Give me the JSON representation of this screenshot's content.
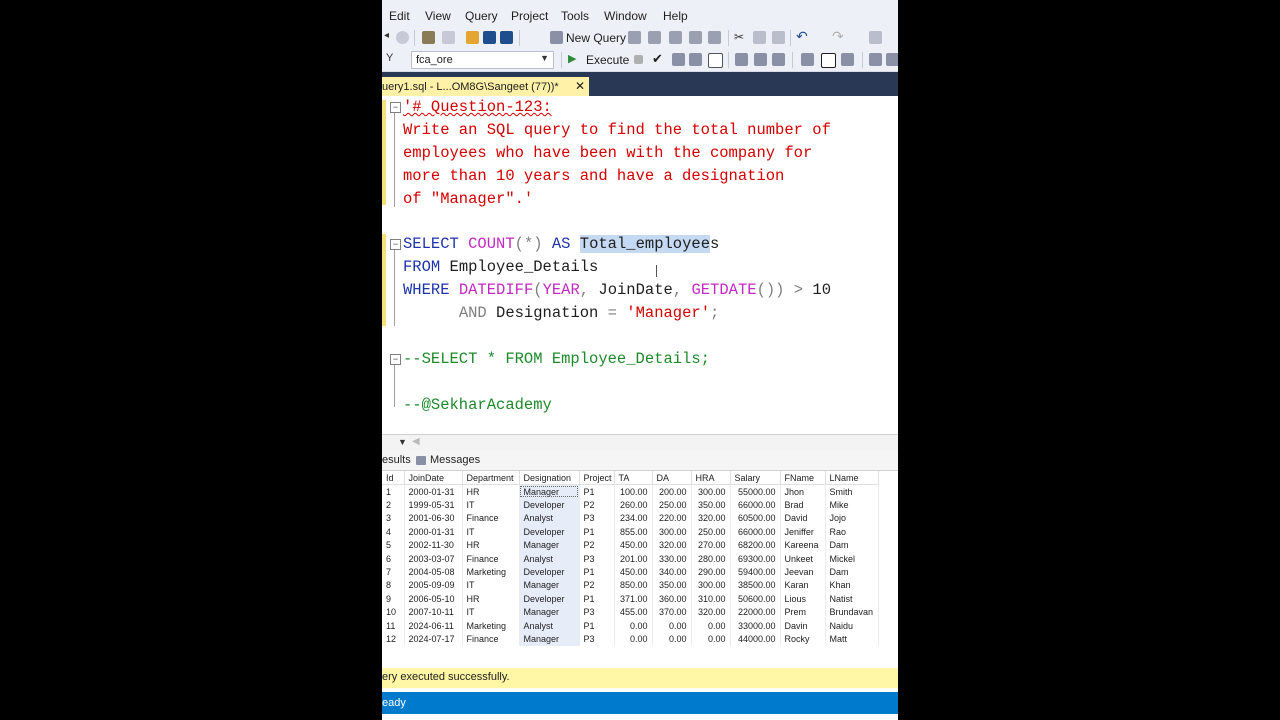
{
  "menu": {
    "items": [
      "Edit",
      "View",
      "Query",
      "Project",
      "Tools",
      "Window",
      "Help"
    ]
  },
  "toolbar": {
    "new_query_label": "New Query",
    "database_value": "fca_ore",
    "execute_label": "Execute"
  },
  "tab": {
    "title": "uery1.sql - L...OM8G\\Sangeet (77))*",
    "close": "✕"
  },
  "editor": {
    "comment_lines": [
      "'# Question-123:",
      "Write an SQL query to find the total number of",
      "employees who have been with the company for",
      "more than 10 years and have a designation",
      "of \"Manager\".'"
    ],
    "q_select": "SELECT",
    "q_count": "COUNT",
    "q_paren": "(*)",
    "q_as": "AS",
    "q_alias": "Total_employee",
    "q_alias_tail": "s",
    "q_from": "FROM",
    "q_table": "Employee_Details",
    "q_where": "WHERE",
    "q_datediff": "DATEDIFF",
    "q_open": "(",
    "q_year": "YEAR",
    "q_comma1": ",",
    "q_joindate": "JoinDate",
    "q_comma2": ",",
    "q_getdate": "GETDATE",
    "q_parens": "())",
    "q_gt": ">",
    "q_ten": "10",
    "q_and": "AND",
    "q_designation": "Designation",
    "q_eq": "=",
    "q_manager": "'Manager'",
    "q_semi": ";",
    "commented_select": "--SELECT * FROM Employee_Details;",
    "signature": "--@SekharAcademy"
  },
  "results": {
    "tabs": [
      "esults",
      "Messages"
    ],
    "columns": [
      "Id",
      "JoinDate",
      "Department",
      "Designation",
      "Project",
      "TA",
      "DA",
      "HRA",
      "Salary",
      "FName",
      "LName"
    ],
    "rows": [
      [
        "1",
        "2000-01-31",
        "HR",
        "Manager",
        "P1",
        "100.00",
        "200.00",
        "300.00",
        "55000.00",
        "Jhon",
        "Smith"
      ],
      [
        "2",
        "1999-05-31",
        "IT",
        "Developer",
        "P2",
        "260.00",
        "250.00",
        "350.00",
        "66000.00",
        "Brad",
        "Mike"
      ],
      [
        "3",
        "2001-06-30",
        "Finance",
        "Analyst",
        "P3",
        "234.00",
        "220.00",
        "320.00",
        "60500.00",
        "David",
        "Jojo"
      ],
      [
        "4",
        "2000-01-31",
        "IT",
        "Developer",
        "P1",
        "855.00",
        "300.00",
        "250.00",
        "66000.00",
        "Jeniffer",
        "Rao"
      ],
      [
        "5",
        "2002-11-30",
        "HR",
        "Manager",
        "P2",
        "450.00",
        "320.00",
        "270.00",
        "68200.00",
        "Kareena",
        "Dam"
      ],
      [
        "6",
        "2003-03-07",
        "Finance",
        "Analyst",
        "P3",
        "201.00",
        "330.00",
        "280.00",
        "69300.00",
        "Unkeet",
        "Mickel"
      ],
      [
        "7",
        "2004-05-08",
        "Marketing",
        "Developer",
        "P1",
        "450.00",
        "340.00",
        "290.00",
        "59400.00",
        "Jeevan",
        "Dam"
      ],
      [
        "8",
        "2005-09-09",
        "IT",
        "Manager",
        "P2",
        "850.00",
        "350.00",
        "300.00",
        "38500.00",
        "Karan",
        "Khan"
      ],
      [
        "9",
        "2006-05-10",
        "HR",
        "Developer",
        "P1",
        "371.00",
        "360.00",
        "310.00",
        "50600.00",
        "Lious",
        "Natist"
      ],
      [
        "10",
        "2007-10-11",
        "IT",
        "Manager",
        "P3",
        "455.00",
        "370.00",
        "320.00",
        "22000.00",
        "Prem",
        "Brundavan"
      ],
      [
        "11",
        "2024-06-11",
        "Marketing",
        "Analyst",
        "P1",
        "0.00",
        "0.00",
        "0.00",
        "33000.00",
        "Davin",
        "Naidu"
      ],
      [
        "12",
        "2024-07-17",
        "Finance",
        "Manager",
        "P3",
        "0.00",
        "0.00",
        "0.00",
        "44000.00",
        "Rocky",
        "Matt"
      ]
    ]
  },
  "status": {
    "query_message": "ery executed successfully.",
    "bar_text": "eady"
  },
  "colors": {
    "status_blue": "#007acc",
    "tab_yellow": "#fff1a8",
    "tabstrip_navy": "#293955",
    "comment_red": "#d40000",
    "keyword_blue": "#1d33ad",
    "function_pink": "#c229c2",
    "comment_green": "#1d8a2a"
  }
}
